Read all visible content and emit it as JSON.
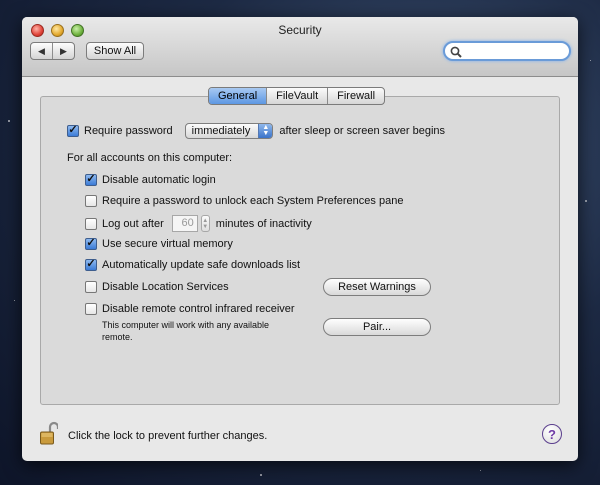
{
  "window": {
    "title": "Security",
    "show_all": "Show All",
    "back_glyph": "◀",
    "forward_glyph": "▶"
  },
  "search": {
    "placeholder": "",
    "icon": "magnifier-icon"
  },
  "tabs": [
    {
      "label": "General",
      "active": true
    },
    {
      "label": "FileVault",
      "active": false
    },
    {
      "label": "Firewall",
      "active": false
    }
  ],
  "general": {
    "require_password": {
      "label": "Require password",
      "checked": true,
      "popup_value": "immediately",
      "suffix": "after sleep or screen saver begins"
    },
    "all_accounts_heading": "For all accounts on this computer:",
    "options": [
      {
        "label": "Disable automatic login",
        "checked": true
      },
      {
        "label": "Require a password to unlock each System Preferences pane",
        "checked": false
      },
      {
        "label": "Log out after",
        "checked": false,
        "value": "60",
        "suffix": "minutes of inactivity"
      },
      {
        "label": "Use secure virtual memory",
        "checked": true
      },
      {
        "label": "Automatically update safe downloads list",
        "checked": true
      },
      {
        "label": "Disable Location Services",
        "checked": false
      },
      {
        "label": "Disable remote control infrared receiver",
        "checked": false
      }
    ],
    "reset_warnings": "Reset Warnings",
    "pair": "Pair...",
    "ir_note_line1": "This computer will work with any available",
    "ir_note_line2": "remote."
  },
  "footer": {
    "lock_text": "Click the lock to prevent further changes.",
    "help": "?"
  },
  "colors": {
    "accent_blue": "#3b7bd6",
    "help_purple": "#6f3ca6",
    "window_bg": "#e8e8e8"
  }
}
